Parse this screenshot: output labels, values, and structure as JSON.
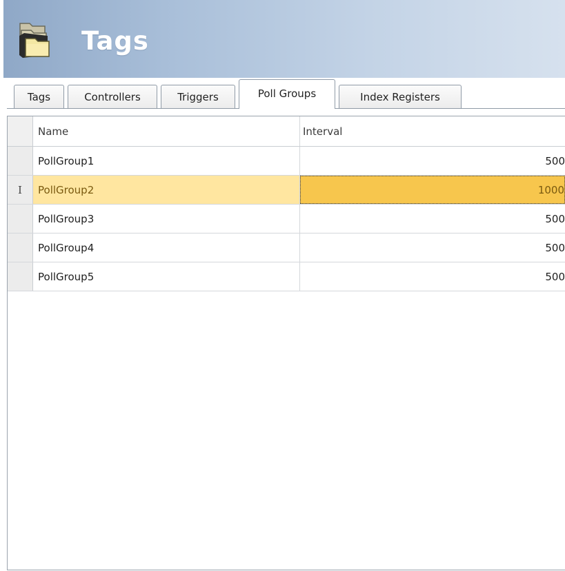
{
  "header": {
    "title": "Tags",
    "icon": "tags-stack-icon",
    "colors": {
      "gradient_start": "#8fa8c7",
      "gradient_end": "#d6e1ee",
      "title": "#ffffff"
    }
  },
  "tabs": [
    {
      "label": "Tags",
      "active": false
    },
    {
      "label": "Controllers",
      "active": false
    },
    {
      "label": "Triggers",
      "active": false
    },
    {
      "label": "Poll Groups",
      "active": true
    },
    {
      "label": "Index Registers",
      "active": false
    }
  ],
  "grid": {
    "columns": [
      "Name",
      "Interval"
    ],
    "rows": [
      {
        "name": "PollGroup1",
        "interval": "500",
        "indicator": ""
      },
      {
        "name": "PollGroup2",
        "interval": "1000",
        "indicator": "I",
        "selected": true
      },
      {
        "name": "PollGroup3",
        "interval": "500",
        "indicator": ""
      },
      {
        "name": "PollGroup4",
        "interval": "500",
        "indicator": ""
      },
      {
        "name": "PollGroup5",
        "interval": "500",
        "indicator": ""
      }
    ],
    "colors": {
      "selected_row": "#ffe6a0",
      "selected_cell": "#f7c64d"
    }
  }
}
